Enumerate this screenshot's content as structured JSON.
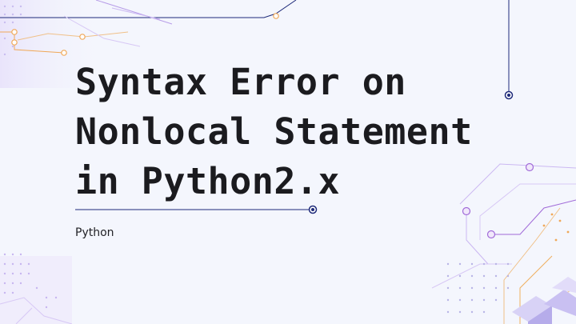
{
  "slide": {
    "title_lines": [
      "Syntax Error on",
      "Nonlocal Statement",
      "in Python2.x"
    ],
    "category": "Python"
  },
  "colors": {
    "background": "#f4f6fd",
    "title_text": "#1b1b1f",
    "navy_line": "#1e2a7a",
    "purple_accent": "#a06ad8",
    "orange_accent": "#f0b060"
  }
}
